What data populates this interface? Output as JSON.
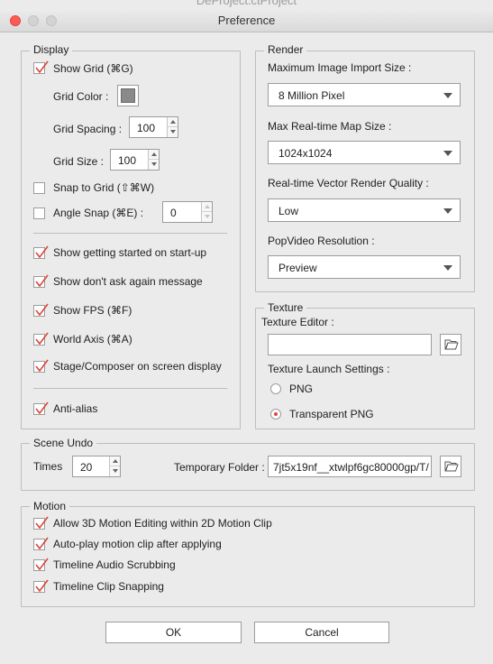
{
  "window": {
    "behind_title": "DeProject.ctProject",
    "title": "Preference"
  },
  "display": {
    "legend": "Display",
    "show_grid": {
      "label": "Show Grid (⌘G)",
      "checked": true
    },
    "grid_color": {
      "label": "Grid Color :",
      "color": "#8a8a8a"
    },
    "grid_spacing": {
      "label": "Grid Spacing :",
      "value": "100"
    },
    "grid_size": {
      "label": "Grid Size :",
      "value": "100"
    },
    "snap_to_grid": {
      "label": "Snap to Grid (⇧⌘W)",
      "checked": false
    },
    "angle_snap": {
      "label": "Angle Snap (⌘E) :",
      "checked": false,
      "value": "0"
    },
    "show_getting_started": {
      "label": "Show getting started on start-up",
      "checked": true
    },
    "show_dont_ask": {
      "label": "Show don't ask again message",
      "checked": true
    },
    "show_fps": {
      "label": "Show FPS (⌘F)",
      "checked": true
    },
    "world_axis": {
      "label": "World Axis (⌘A)",
      "checked": true
    },
    "stage_composer": {
      "label": "Stage/Composer on screen display",
      "checked": true
    },
    "anti_alias": {
      "label": "Anti-alias",
      "checked": true
    }
  },
  "render": {
    "legend": "Render",
    "max_image_import": {
      "label": "Maximum Image Import Size :",
      "value": "8 Million Pixel"
    },
    "max_realtime_map": {
      "label": "Max Real-time Map Size :",
      "value": "1024x1024"
    },
    "vector_quality": {
      "label": "Real-time Vector Render Quality :",
      "value": "Low"
    },
    "popvideo_resolution": {
      "label": "PopVideo Resolution :",
      "value": "Preview"
    }
  },
  "texture": {
    "legend": "Texture",
    "editor_label": "Texture Editor :",
    "editor_value": "",
    "launch_label": "Texture Launch Settings :",
    "options": [
      {
        "label": "PNG",
        "selected": false
      },
      {
        "label": "Transparent PNG",
        "selected": true
      }
    ]
  },
  "scene_undo": {
    "legend": "Scene Undo",
    "times_label": "Times",
    "times_value": "20",
    "temp_folder_label": "Temporary Folder :",
    "temp_folder_value": "7jt5x19nf__xtwlpf6gc80000gp/T/"
  },
  "motion": {
    "legend": "Motion",
    "items": [
      {
        "label": "Allow 3D Motion Editing within 2D Motion Clip",
        "checked": true
      },
      {
        "label": "Auto-play motion clip after applying",
        "checked": true
      },
      {
        "label": "Timeline Audio Scrubbing",
        "checked": true
      },
      {
        "label": "Timeline Clip Snapping",
        "checked": true
      }
    ]
  },
  "buttons": {
    "ok": "OK",
    "cancel": "Cancel"
  },
  "colors": {
    "check": "#d9453c",
    "close": "#fc5b57"
  },
  "icons": {
    "folder": "folder-open-icon"
  }
}
